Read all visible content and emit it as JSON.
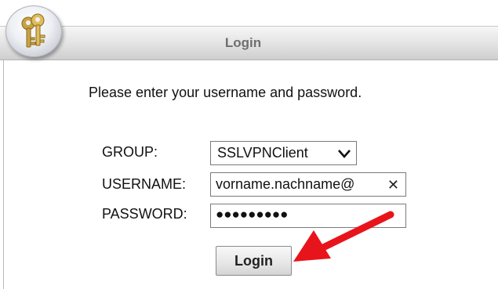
{
  "header": {
    "title": "Login",
    "logo_icon": "keys-icon"
  },
  "form": {
    "instructions": "Please enter your username and password.",
    "group_label": "GROUP:",
    "group_value": "SSLVPNClient",
    "username_label": "USERNAME:",
    "username_value": "vorname.nachname@",
    "password_label": "PASSWORD:",
    "password_masked": "●●●●●●●●●",
    "clear_symbol": "✕",
    "login_button": "Login"
  },
  "annotation": {
    "arrow_color": "#e8141c"
  }
}
